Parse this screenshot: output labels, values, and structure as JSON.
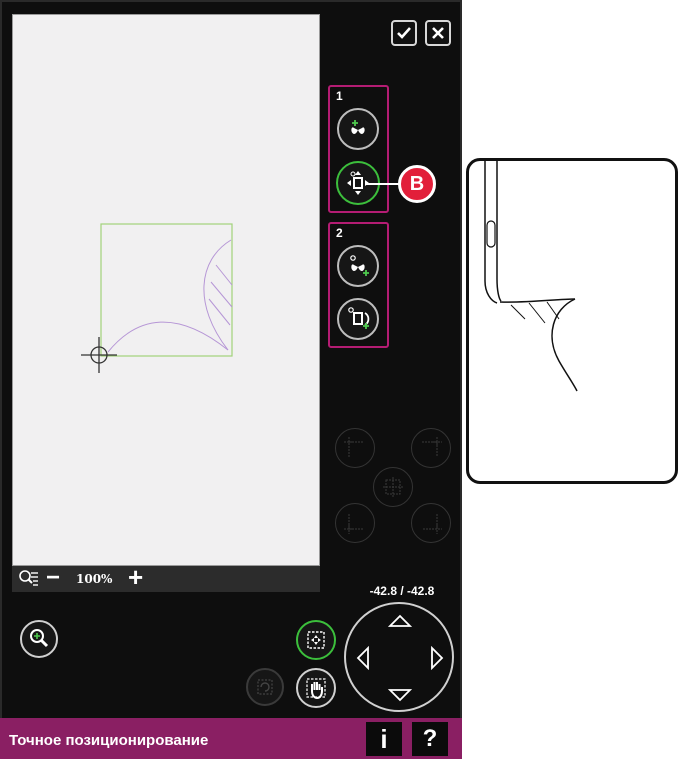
{
  "colors": {
    "accent": "#8a1f63",
    "group_border": "#b41c73",
    "active_ring": "#3cbf3c",
    "callout": "#e21f3a",
    "design_frame": "#a2d27a",
    "stitch": "#b696d6"
  },
  "toolbar": {
    "ok_icon": "checkmark-icon",
    "cancel_icon": "close-icon"
  },
  "groups": [
    {
      "label": "1",
      "buttons": [
        "set-anchor-point-icon",
        "move-to-position-icon"
      ]
    },
    {
      "label": "2",
      "buttons": [
        "set-match-point-icon",
        "rotate-to-point-icon"
      ]
    }
  ],
  "callout": {
    "label": "B"
  },
  "zoom": {
    "minus": "−",
    "level": "100%",
    "plus": "+"
  },
  "position": {
    "coords": "-42.8 / -42.8"
  },
  "footer": {
    "title": "Точное позиционирование",
    "info": "i",
    "help": "?"
  }
}
